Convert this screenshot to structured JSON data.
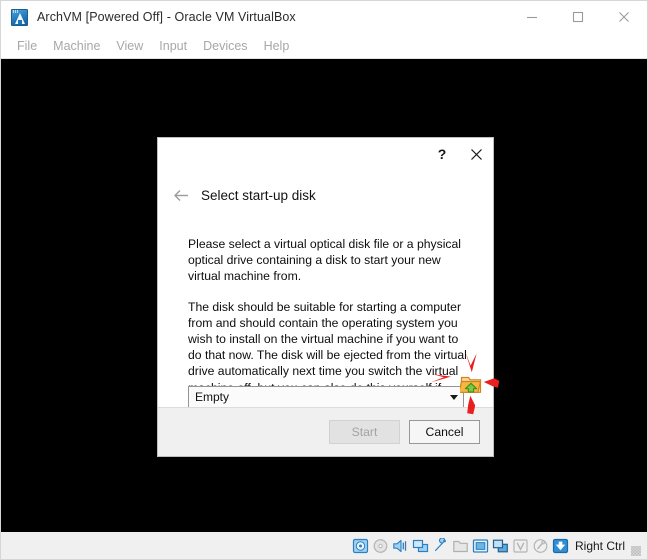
{
  "window": {
    "app_icon": "virtualbox-app-icon",
    "title": "ArchVM [Powered Off] - Oracle VM VirtualBox",
    "controls": {
      "minimize": "minimize-icon",
      "maximize": "maximize-icon",
      "close": "close-icon"
    }
  },
  "menubar": {
    "items": [
      {
        "label": "File"
      },
      {
        "label": "Machine"
      },
      {
        "label": "View"
      },
      {
        "label": "Input"
      },
      {
        "label": "Devices"
      },
      {
        "label": "Help"
      }
    ]
  },
  "vm_screen": {
    "background_color": "#000000"
  },
  "dialog": {
    "help_label": "?",
    "close_label": "✕",
    "back_label": "←",
    "heading": "Select start-up disk",
    "paragraphs": [
      "Please select a virtual optical disk file or a physical optical drive containing a disk to start your new virtual machine from.",
      "The disk should be suitable for starting a computer from and should contain the operating system you wish to install on the virtual machine if you want to do that now. The disk will be ejected from the virtual drive automatically next time you switch the virtual machine off, but you can also do this yourself if needed using the Devices menu."
    ],
    "disk_select": {
      "value": "Empty",
      "placeholder": "Empty",
      "options": [
        "Empty"
      ]
    },
    "browse_icon": "open-folder-icon",
    "buttons": {
      "start": {
        "label": "Start",
        "enabled": false
      },
      "cancel": {
        "label": "Cancel",
        "enabled": true
      }
    }
  },
  "annotations": {
    "color": "#e8201e",
    "arrows": [
      {
        "name": "arrow-pointing-down-at-browse-icon",
        "direction": "down"
      },
      {
        "name": "arrow-pointing-up-at-browse-icon",
        "direction": "up"
      },
      {
        "name": "arrow-pointing-right-at-browse-icon",
        "direction": "right"
      },
      {
        "name": "arrow-pointing-left-at-browse-icon",
        "direction": "left"
      }
    ]
  },
  "statusbar": {
    "icons": [
      {
        "name": "hard-disk-icon",
        "enabled": true
      },
      {
        "name": "optical-disk-icon",
        "enabled": false
      },
      {
        "name": "audio-icon",
        "enabled": true
      },
      {
        "name": "network-icon",
        "enabled": true
      },
      {
        "name": "usb-icon",
        "enabled": true
      },
      {
        "name": "shared-folders-icon",
        "enabled": false
      },
      {
        "name": "display-icon",
        "enabled": true
      },
      {
        "name": "recording-icon",
        "enabled": true
      },
      {
        "name": "virtualization-icon",
        "enabled": false
      },
      {
        "name": "mouse-integration-icon",
        "enabled": false
      },
      {
        "name": "host-key-icon",
        "enabled": true
      }
    ],
    "host_key_label": "Right Ctrl",
    "resize_grip": "resize-grip-icon"
  },
  "colors": {
    "accent_blue": "#2277bb",
    "annotation_red": "#e8201e",
    "folder_orange": "#f2a93b",
    "folder_green": "#6cbf3f",
    "chrome_grey": "#f0f0f0"
  }
}
